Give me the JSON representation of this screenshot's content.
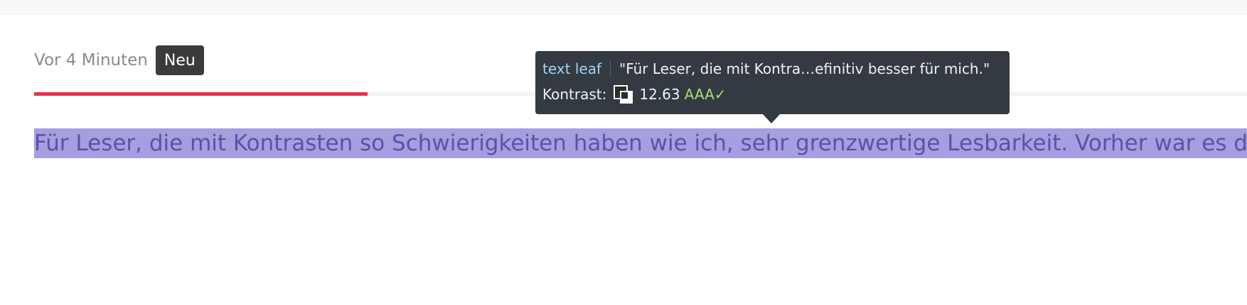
{
  "header": {
    "timestamp": "Vor 4 Minuten",
    "badge": "Neu"
  },
  "reading_progress": {
    "fraction": 0.275,
    "fill_color": "#e63346",
    "track_color": "#f2f2f6"
  },
  "comment": {
    "text": "Für Leser, die mit Kontrasten so Schwierigkeiten haben wie ich, sehr grenzwertige Lesbarkeit. Vorher war es definitiv besser für mich."
  },
  "inspector_tooltip": {
    "role": "text leaf",
    "name": "\"Für Leser, die mit Kontra…efinitiv besser für mich.\"",
    "contrast_label": "Kontrast:",
    "contrast_icon": "contrast-swatch-icon",
    "contrast_value": "12.63",
    "rating": "AAA✓"
  }
}
